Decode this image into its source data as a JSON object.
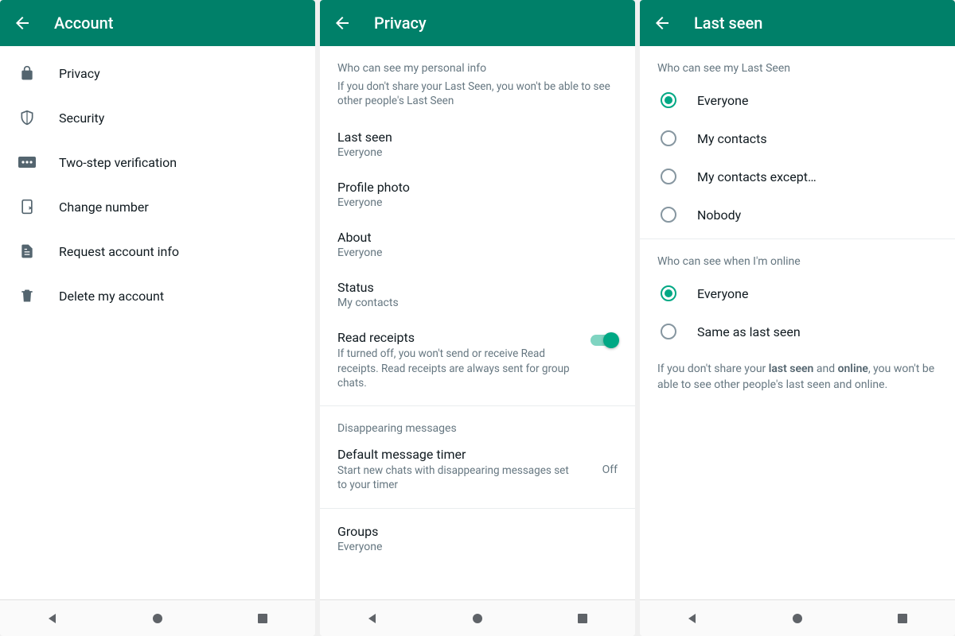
{
  "panel1": {
    "title": "Account",
    "items": [
      {
        "icon": "lock",
        "label": "Privacy"
      },
      {
        "icon": "shield",
        "label": "Security"
      },
      {
        "icon": "pin",
        "label": "Two-step verification"
      },
      {
        "icon": "sim",
        "label": "Change number"
      },
      {
        "icon": "doc",
        "label": "Request account info"
      },
      {
        "icon": "trash",
        "label": "Delete my account"
      }
    ]
  },
  "panel2": {
    "title": "Privacy",
    "section1_header": "Who can see my personal info",
    "section1_sub": "If you don't share your Last Seen, you won't be able to see other people's Last Seen",
    "last_seen": {
      "title": "Last seen",
      "value": "Everyone"
    },
    "profile_photo": {
      "title": "Profile photo",
      "value": "Everyone"
    },
    "about": {
      "title": "About",
      "value": "Everyone"
    },
    "status": {
      "title": "Status",
      "value": "My contacts"
    },
    "read_receipts": {
      "title": "Read receipts",
      "desc": "If turned off, you won't send or receive Read receipts. Read receipts are always sent for group chats.",
      "on": true
    },
    "section2_header": "Disappearing messages",
    "default_timer": {
      "title": "Default message timer",
      "desc": "Start new chats with disappearing messages set to your timer",
      "value": "Off"
    },
    "groups": {
      "title": "Groups",
      "value": "Everyone"
    }
  },
  "panel3": {
    "title": "Last seen",
    "section1_header": "Who can see my Last Seen",
    "options1": [
      {
        "label": "Everyone",
        "checked": true
      },
      {
        "label": "My contacts",
        "checked": false
      },
      {
        "label": "My contacts except…",
        "checked": false
      },
      {
        "label": "Nobody",
        "checked": false
      }
    ],
    "section2_header": "Who can see when I'm online",
    "options2": [
      {
        "label": "Everyone",
        "checked": true
      },
      {
        "label": "Same as last seen",
        "checked": false
      }
    ],
    "footnote_pre": "If you don't share your ",
    "footnote_b1": "last seen",
    "footnote_mid": " and ",
    "footnote_b2": "online",
    "footnote_post": ", you won't be able to see other people's last seen and online."
  }
}
